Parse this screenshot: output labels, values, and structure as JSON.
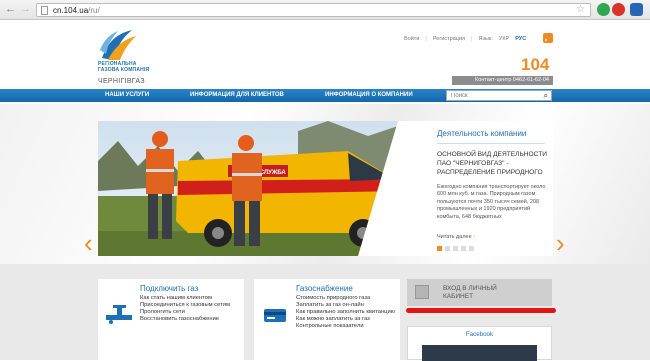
{
  "browser": {
    "url_host": "cn.104.ua",
    "url_path": "/ru/"
  },
  "header": {
    "logo_lines": [
      "РЕГІОНАЛЬНА",
      "ГАЗОВА КОМПАНІЯ"
    ],
    "city": "ЧЕРНІГІВГАЗ",
    "links": {
      "login": "Войти",
      "register": "Регистрация",
      "lang_label": "Язык:",
      "lang_ukr": "УКР",
      "lang_rus": "РУС"
    },
    "phone_short": "104",
    "contact_center": "Контакт-центр 0462-61-62-04"
  },
  "nav": {
    "items": [
      "НАШИ УСЛУГИ",
      "ИНФОРМАЦИЯ ДЛЯ КЛИЕНТОВ",
      "ИНФОРМАЦИЯ О КОМПАНИИ"
    ],
    "search_placeholder": "Поиск"
  },
  "slide": {
    "title": "Деятельность компании",
    "headline": "ОСНОВНОЙ ВИД ДЕЯТЕЛЬНОСТИ ПАО \"ЧЕРНИГОВГАЗ\" - РАСПРЕДЕЛЕНИЕ ПРИРОДНОГО",
    "body": "Ежегодно компания транспортирует около 600 млн куб. м газа. Природным газом пользуются почти 350 тысяч семей, 208 промышленных и 1920 предприятий комбыта, 648 бюджетных",
    "more": "Читать далее",
    "more_arrow": "›",
    "van_text": "ГАЗОВА СЛУЖБА"
  },
  "cards": [
    {
      "title": "Подключить газ",
      "items": [
        "Как стать нашим клиентом",
        "Присоединиться к газовым сетям",
        "Пролонгить сети",
        "Восстановить газоснабжение"
      ]
    },
    {
      "title": "Газоснабжение",
      "items": [
        "Стоимость природного газа",
        "Заплатить за газ он-лайн",
        "Как правильно заполнить квитанцию",
        "Как можно заплатить за газ",
        "Контрольные показатели"
      ]
    }
  ],
  "login": {
    "line1": "ВХОД В ЛИЧНЫЙ",
    "line2": "КАБИНЕТ"
  },
  "facebook": {
    "title": "Facebook"
  },
  "colors": {
    "brand_blue": "#1f6fb5",
    "accent_orange": "#f08a24",
    "annotation_red": "#e21414"
  }
}
